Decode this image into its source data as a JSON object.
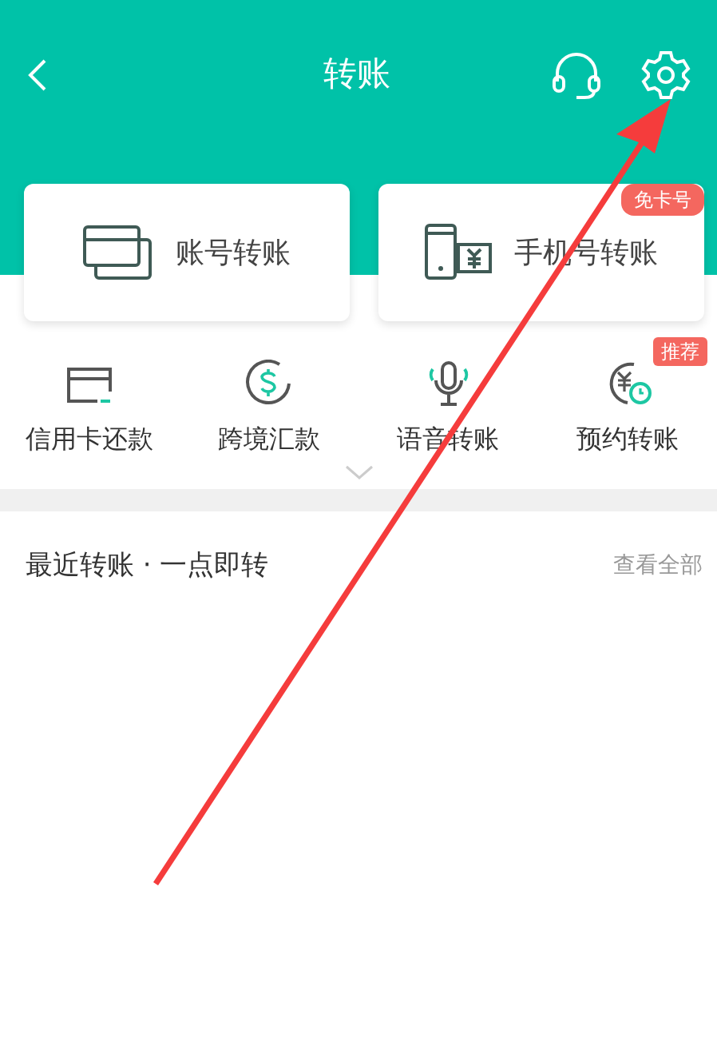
{
  "header": {
    "title": "转账"
  },
  "transfer_cards": [
    {
      "label": "账号转账",
      "kind": "account"
    },
    {
      "label": "手机号转账",
      "kind": "phone",
      "badge": "免卡号"
    }
  ],
  "services": [
    {
      "label": "信用卡还款",
      "kind": "card"
    },
    {
      "label": "跨境汇款",
      "kind": "dollar"
    },
    {
      "label": "语音转账",
      "kind": "voice"
    },
    {
      "label": "预约转账",
      "kind": "schedule",
      "badge": "推荐"
    }
  ],
  "recent": {
    "title": "最近转账 · 一点即转",
    "link": "查看全部"
  }
}
